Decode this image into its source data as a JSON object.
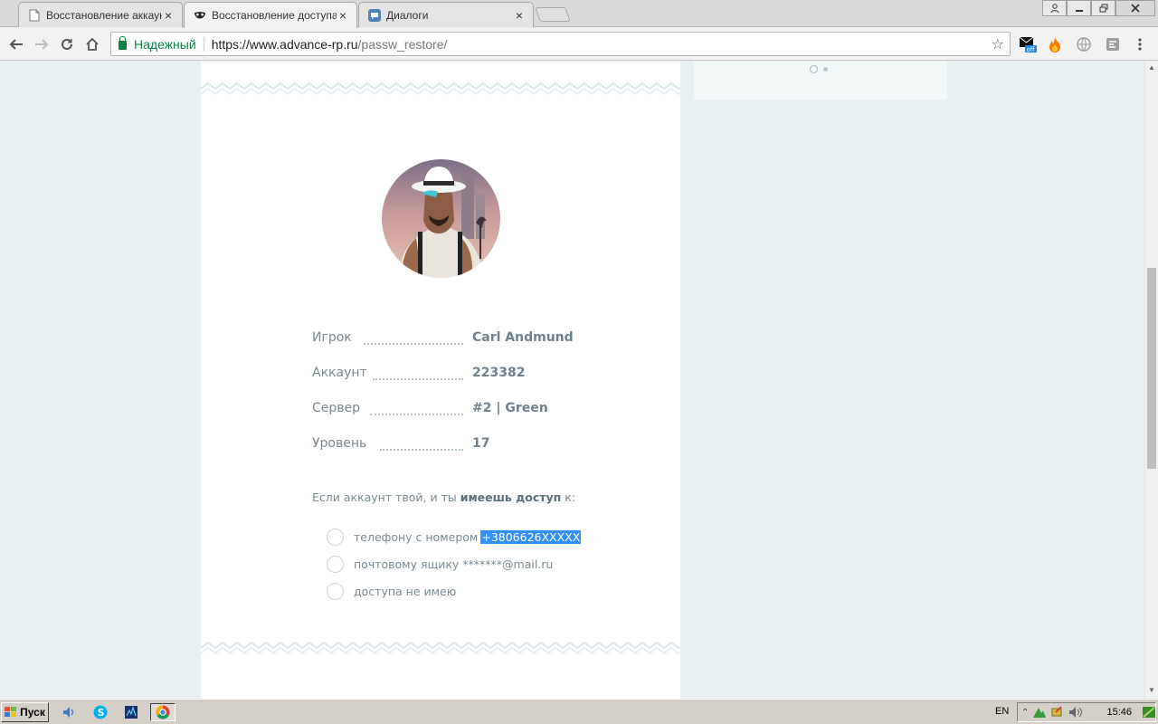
{
  "browser": {
    "tabs": [
      {
        "title": "Восстановление аккаунто",
        "active": false
      },
      {
        "title": "Восстановление доступа |",
        "active": true
      },
      {
        "title": "Диалоги",
        "active": false
      }
    ],
    "address": {
      "secure_label": "Надежный",
      "url_host": "https://www.advance-rp.ru",
      "url_path": "/passw_restore/"
    },
    "extensions": [
      {
        "icon": "mail-off-icon",
        "badge": "off"
      },
      {
        "icon": "flame-icon"
      },
      {
        "icon": "globe-icon"
      },
      {
        "icon": "puzzle-icon"
      }
    ]
  },
  "page": {
    "info": [
      {
        "label": "Игрок",
        "value": "Carl Andmund"
      },
      {
        "label": "Аккаунт",
        "value": "223382"
      },
      {
        "label": "Сервер",
        "value": "#2 | Green"
      },
      {
        "label": "Уровень",
        "value": "17"
      }
    ],
    "question": {
      "prefix": "Если аккаунт твой, и ты ",
      "bold": "имеешь доступ",
      "suffix": " к:"
    },
    "options": [
      {
        "label": "телефону с номером",
        "highlight": "+3806626XXXXX"
      },
      {
        "label": "почтовому ящику *******@mail.ru"
      },
      {
        "label": "доступа не имею"
      }
    ]
  },
  "taskbar": {
    "start_label": "Пуск",
    "language": "EN",
    "clock": "15:46"
  },
  "colors": {
    "page_bg": "#e8f0f2",
    "card_bg": "#ffffff",
    "label": "#7a8a92",
    "value": "#6f818a",
    "selection": "#3390ff",
    "secure_green": "#0b8043"
  }
}
